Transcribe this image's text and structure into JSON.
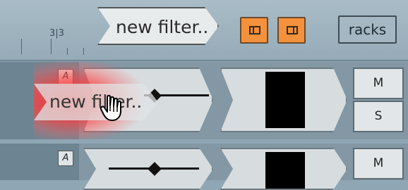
{
  "ruler": {
    "label": "3|3"
  },
  "toolbar": {
    "new_filter_label": "new filter..",
    "racks_label": "racks",
    "accent_color": "#f4913c"
  },
  "rows": [
    {
      "badge": "A",
      "mute_label": "M",
      "solo_label": "S"
    },
    {
      "badge": "A",
      "mute_label": "M"
    }
  ],
  "drag": {
    "ghost_label": "new filter.."
  },
  "icons": [
    "layout-left-icon",
    "layout-right-icon",
    "hand-cursor-icon",
    "diamond-knob-icon"
  ]
}
